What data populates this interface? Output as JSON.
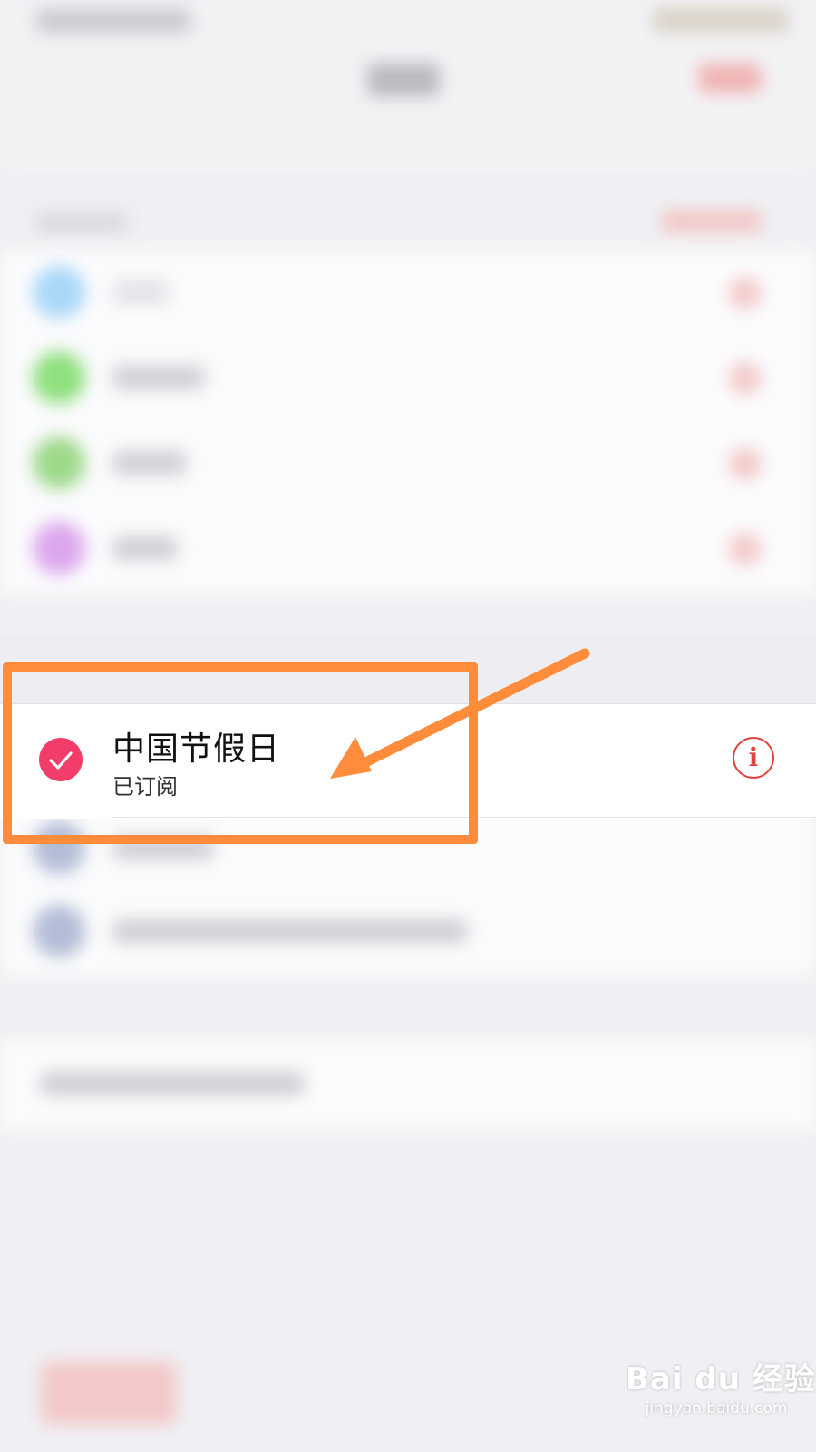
{
  "calendar_row": {
    "name": "中国节假日",
    "status": "已订阅",
    "checked": true,
    "check_color": "#f23d6b",
    "info_icon": "info-circle-icon",
    "info_color": "#e0443f"
  },
  "annotation": {
    "color": "#ff8c3a",
    "highlight": "box around calendar row",
    "arrow_icon": "arrow-pointer-icon"
  },
  "watermark": {
    "logo": "Bai du 经验",
    "url": "jingyan.baidu.com"
  }
}
